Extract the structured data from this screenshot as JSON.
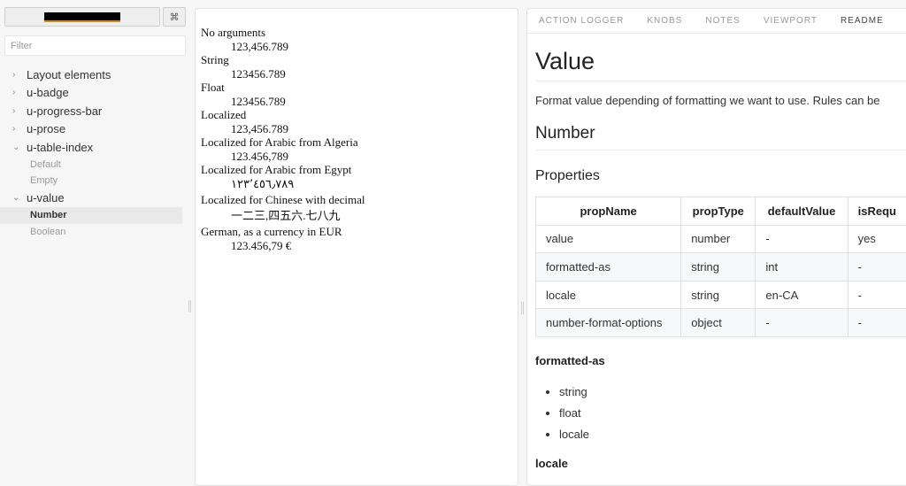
{
  "sidebar": {
    "shortcut_icon": "⌘",
    "filter_placeholder": "Filter",
    "kinds": [
      {
        "arrow": "›",
        "label": "Layout elements"
      },
      {
        "arrow": "›",
        "label": "u-badge"
      },
      {
        "arrow": "›",
        "label": "u-progress-bar"
      },
      {
        "arrow": "›",
        "label": "u-prose"
      },
      {
        "arrow": "⌄",
        "label": "u-table-index"
      },
      {
        "arrow": "⌄",
        "label": "u-value"
      }
    ],
    "table_index_stories": [
      "Default",
      "Empty"
    ],
    "value_stories": [
      "Number",
      "Boolean"
    ]
  },
  "preview": {
    "items": [
      {
        "label": "No arguments",
        "value": "123,456.789"
      },
      {
        "label": "String",
        "value": "123456.789"
      },
      {
        "label": "Float",
        "value": "123456.789"
      },
      {
        "label": "Localized",
        "value": "123,456.789"
      },
      {
        "label": "Localized for Arabic from Algeria",
        "value": "123.456,789"
      },
      {
        "label": "Localized for Arabic from Egypt",
        "value": "١٢٣٬٤٥٦٫٧٨٩"
      },
      {
        "label": "Localized for Chinese with decimal",
        "value": "一二三,四五六.七八九"
      },
      {
        "label": "German, as a currency in EUR",
        "value": "123.456,79 €"
      }
    ]
  },
  "panel": {
    "tabs": [
      "ACTION LOGGER",
      "KNOBS",
      "NOTES",
      "VIEWPORT",
      "README"
    ],
    "active_tab": "README",
    "title": "Value",
    "intro": "Format value depending of formatting we want to use. Rules can be",
    "section": "Number",
    "properties_heading": "Properties",
    "table": {
      "headers": [
        "propName",
        "propType",
        "defaultValue",
        "isRequ"
      ],
      "rows": [
        [
          "value",
          "number",
          "-",
          "yes"
        ],
        [
          "formatted-as",
          "string",
          "int",
          "-"
        ],
        [
          "locale",
          "string",
          "en-CA",
          "-"
        ],
        [
          "number-format-options",
          "object",
          "-",
          "-"
        ]
      ]
    },
    "formatted_as_heading": "formatted-as",
    "formatted_as_items": [
      "string",
      "float",
      "locale"
    ],
    "locale_heading": "locale"
  }
}
